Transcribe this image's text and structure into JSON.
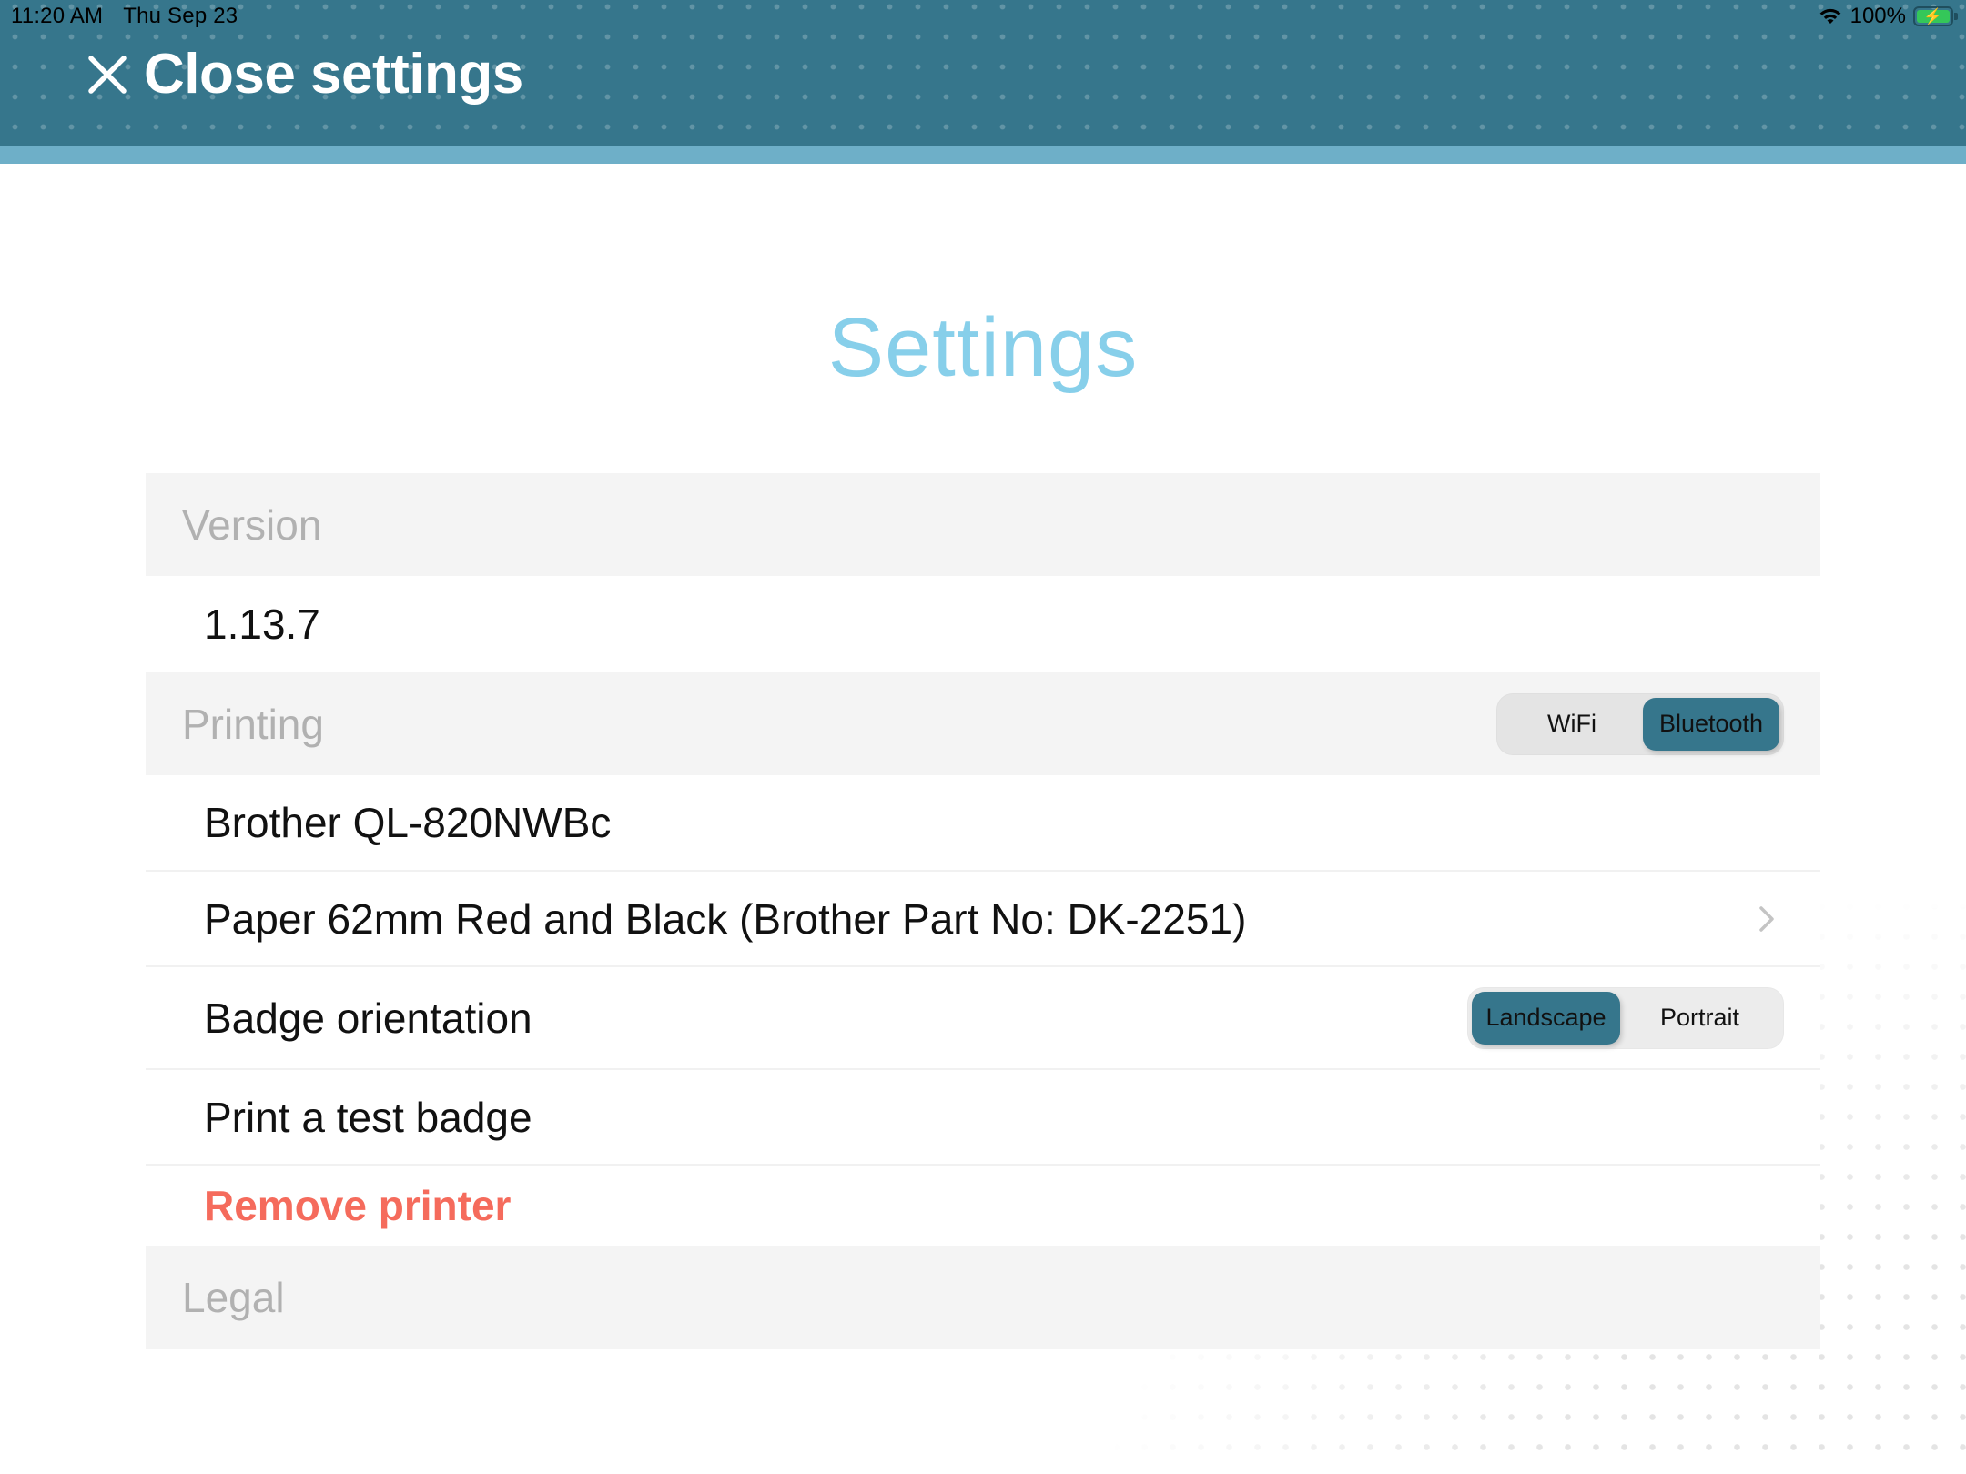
{
  "status_bar": {
    "time": "11:20 AM",
    "date": "Thu Sep 23",
    "wifi_icon": "wifi-icon",
    "battery_percent": "100%",
    "battery_level": 1.0,
    "battery_state": "charging",
    "battery_bolt": "⚡"
  },
  "header": {
    "close_icon": "close-icon",
    "close_label": "Close settings",
    "background_color": "#36768c",
    "stripe_color": "#6eafc8"
  },
  "main": {
    "title": "Settings",
    "title_color": "#87cfea",
    "sections": {
      "version": {
        "title": "Version",
        "value": "1.13.7"
      },
      "printing": {
        "title": "Printing",
        "connection_toggle": {
          "options": [
            "WiFi",
            "Bluetooth"
          ],
          "selected": "Bluetooth"
        },
        "printer_name": "Brother QL-820NWBc",
        "paper": "Paper 62mm Red and Black (Brother Part No: DK-2251)",
        "paper_chevron_icon": "chevron-right-icon",
        "orientation": {
          "label": "Badge orientation",
          "options": [
            "Landscape",
            "Portrait"
          ],
          "selected": "Landscape"
        },
        "print_test_label": "Print a test badge",
        "remove_printer_label": "Remove printer",
        "danger_color": "#f56b5c"
      },
      "legal": {
        "title": "Legal"
      }
    },
    "accent_color": "#36768c",
    "highlight_color": "#f5aa14"
  }
}
